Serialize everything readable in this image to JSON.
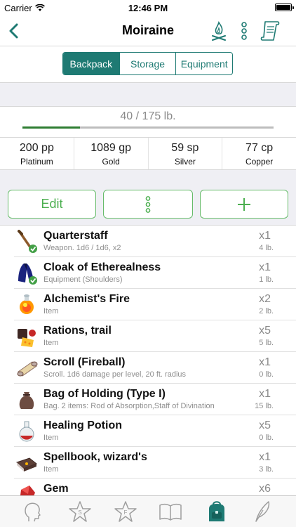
{
  "status_bar": {
    "carrier": "Carrier",
    "time": "12:46 PM"
  },
  "nav": {
    "title": "Moiraine"
  },
  "segments": [
    {
      "label": "Backpack",
      "active": true
    },
    {
      "label": "Storage",
      "active": false
    },
    {
      "label": "Equipment",
      "active": false
    }
  ],
  "weight": {
    "text": "40 / 175 lb.",
    "fraction": 0.23
  },
  "coins": [
    {
      "value": "200 pp",
      "name": "Platinum"
    },
    {
      "value": "1089 gp",
      "name": "Gold"
    },
    {
      "value": "59 sp",
      "name": "Silver"
    },
    {
      "value": "77 cp",
      "name": "Copper"
    }
  ],
  "actions": {
    "edit_label": "Edit"
  },
  "items": [
    {
      "name": "Quarterstaff",
      "desc": "Weapon. 1d6 / 1d6, x2",
      "qty": "x1",
      "weight": "4 lb.",
      "icon": "quarterstaff-icon",
      "equipped": true
    },
    {
      "name": "Cloak of Etherealness",
      "desc": "Equipment (Shoulders)",
      "qty": "x1",
      "weight": "1 lb.",
      "icon": "cloak-icon",
      "equipped": true
    },
    {
      "name": "Alchemist's Fire",
      "desc": "Item",
      "qty": "x2",
      "weight": "2 lb.",
      "icon": "flask-fire-icon",
      "equipped": false
    },
    {
      "name": "Rations, trail",
      "desc": "Item",
      "qty": "x5",
      "weight": "5 lb.",
      "icon": "rations-icon",
      "equipped": false
    },
    {
      "name": "Scroll (Fireball)",
      "desc": "Scroll. 1d6 damage per level, 20 ft. radius",
      "qty": "x1",
      "weight": "0 lb.",
      "icon": "scroll-icon",
      "equipped": false
    },
    {
      "name": "Bag of Holding (Type I)",
      "desc": "Bag. 2 items: Rod of Absorption,Staff of Divination",
      "qty": "x1",
      "weight": "15 lb.",
      "icon": "bag-icon",
      "equipped": false
    },
    {
      "name": "Healing Potion",
      "desc": "Item",
      "qty": "x5",
      "weight": "0 lb.",
      "icon": "potion-icon",
      "equipped": false
    },
    {
      "name": "Spellbook, wizard's",
      "desc": "Item",
      "qty": "x1",
      "weight": "3 lb.",
      "icon": "spellbook-icon",
      "equipped": false
    },
    {
      "name": "Gem",
      "desc": "",
      "qty": "x6",
      "weight": "",
      "icon": "gem-icon",
      "equipped": false
    }
  ],
  "colors": {
    "accent": "#1e7a73",
    "action_green": "#4caf50",
    "progress": "#2e7d32"
  },
  "tabs": [
    {
      "icon": "head-icon",
      "letter": ""
    },
    {
      "icon": "star-s-icon",
      "letter": "S"
    },
    {
      "icon": "star-f-icon",
      "letter": "F"
    },
    {
      "icon": "book-icon",
      "letter": ""
    },
    {
      "icon": "backpack-icon",
      "letter": ""
    },
    {
      "icon": "quill-icon",
      "letter": ""
    }
  ]
}
